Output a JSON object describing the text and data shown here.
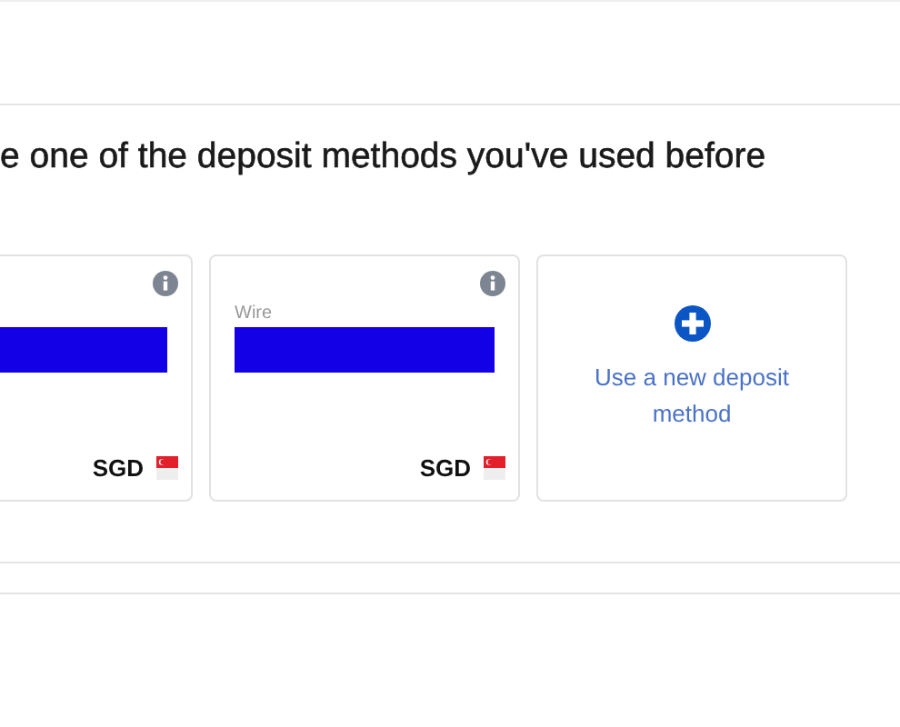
{
  "heading": "e one of the deposit methods you've used before",
  "methods": [
    {
      "kind": "saved",
      "currency": "SGD"
    },
    {
      "kind": "saved",
      "label": "Wire",
      "currency": "SGD"
    },
    {
      "kind": "new",
      "label": "Use a new deposit method"
    }
  ]
}
